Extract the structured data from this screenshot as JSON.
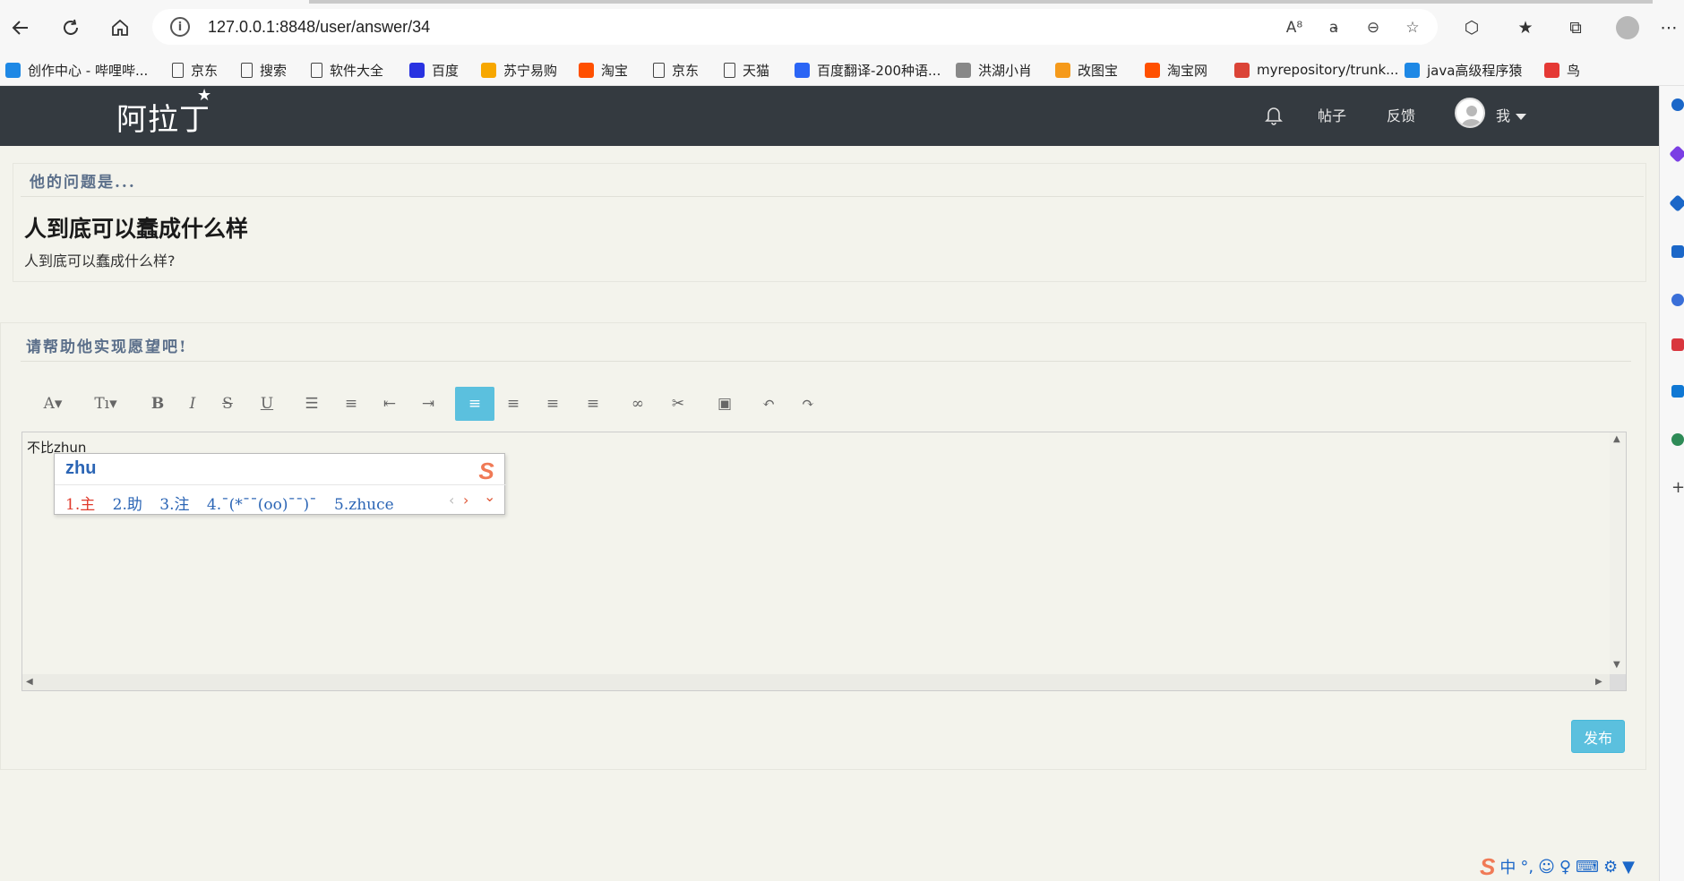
{
  "browser": {
    "url": "127.0.0.1:8848/user/answer/34",
    "info_icon_glyph": "i",
    "nav_icons": [
      "back-arrow-icon",
      "reload-icon",
      "home-icon"
    ],
    "address_icons": [
      "read-aloud-icon",
      "translate-icon",
      "zoom-out-icon",
      "add-favorite-icon"
    ],
    "address_icon_glyphs": [
      "A⁸",
      "a̵",
      "⊖",
      "☆"
    ],
    "toolbar_icons": [
      "extensions-icon",
      "favorites-icon",
      "collections-icon",
      "profile-icon",
      "more-icon"
    ],
    "toolbar_icon_glyphs": [
      "⬡",
      "★",
      "⧉",
      "",
      "⋯"
    ]
  },
  "bookmarks": [
    {
      "label": "创作中心 - 哔哩哔...",
      "icon": "bilibili-icon",
      "color": "#1e88e5"
    },
    {
      "label": "京东",
      "icon": "page-icon"
    },
    {
      "label": "搜索",
      "icon": "page-icon"
    },
    {
      "label": "软件大全",
      "icon": "page-icon"
    },
    {
      "label": "百度",
      "icon": "baidu-paw-icon",
      "color": "#2932e1"
    },
    {
      "label": "苏宁易购",
      "icon": "suning-icon",
      "color": "#f7a700"
    },
    {
      "label": "淘宝",
      "icon": "taobao-icon",
      "color": "#ff5000"
    },
    {
      "label": "京东",
      "icon": "page-icon"
    },
    {
      "label": "天猫",
      "icon": "page-icon"
    },
    {
      "label": "百度翻译-200种语...",
      "icon": "baidu-translate-icon",
      "color": "#2b65f5"
    },
    {
      "label": "洪湖小肖",
      "icon": "bird-icon",
      "color": "#888888"
    },
    {
      "label": "改图宝",
      "icon": "gaitubao-icon",
      "color": "#f59a1b"
    },
    {
      "label": "淘宝网",
      "icon": "taobao-icon",
      "color": "#ff5000"
    },
    {
      "label": "myrepository/trunk...",
      "icon": "chrome-icon",
      "color": "#db4437"
    },
    {
      "label": "java高级程序猿",
      "icon": "bilibili-icon",
      "color": "#1e88e5"
    },
    {
      "label": "鸟",
      "icon": "bird-red-icon",
      "color": "#e53935"
    }
  ],
  "header": {
    "logo": "阿拉丁",
    "logo_star": "★",
    "nav": [
      {
        "label": "帖子"
      },
      {
        "label": "反馈"
      }
    ],
    "user_label": "我"
  },
  "question": {
    "section_title": "他的问题是...",
    "title": "人到底可以蠢成什么样",
    "body": "人到底可以蠢成什么样?"
  },
  "answer": {
    "section_title": "请帮助他实现愿望吧!",
    "toolbar": [
      {
        "name": "font-family-button",
        "glyph": "A▾"
      },
      {
        "name": "font-size-button",
        "glyph": "Tı▾"
      },
      {
        "name": "bold-button",
        "glyph": "B"
      },
      {
        "name": "italic-button",
        "glyph": "I"
      },
      {
        "name": "strikethrough-button",
        "glyph": "S"
      },
      {
        "name": "underline-button",
        "glyph": "U"
      },
      {
        "name": "bullet-list-button",
        "glyph": "☰"
      },
      {
        "name": "numbered-list-button",
        "glyph": "≡"
      },
      {
        "name": "outdent-button",
        "glyph": "⇤"
      },
      {
        "name": "indent-button",
        "glyph": "⇥"
      },
      {
        "name": "align-left-button",
        "glyph": "≡",
        "active": true
      },
      {
        "name": "align-center-button",
        "glyph": "≡"
      },
      {
        "name": "align-right-button",
        "glyph": "≡"
      },
      {
        "name": "justify-button",
        "glyph": "≡"
      },
      {
        "name": "link-button",
        "glyph": "∞"
      },
      {
        "name": "unlink-button",
        "glyph": "✂"
      },
      {
        "name": "image-button",
        "glyph": "▣"
      },
      {
        "name": "undo-button",
        "glyph": "↶"
      },
      {
        "name": "redo-button",
        "glyph": "↷"
      }
    ],
    "editor_text": "不比zhun",
    "publish_label": "发布"
  },
  "ime": {
    "input": "zhu",
    "candidates": [
      "1.主",
      "2.助",
      "3.注",
      "4.¯(*¯¯(oo)¯¯)¯",
      "5.zhuce"
    ],
    "logo": "S",
    "nav_prev": "‹",
    "nav_next": "›",
    "nav_expand": "⌄"
  },
  "tray": {
    "items": [
      "S",
      "中",
      "°,",
      "☺",
      "♀",
      "⌨",
      "⚙",
      "▼"
    ]
  },
  "colors": {
    "header_bg": "#343a40",
    "accent": "#5bc0de",
    "page_bg": "#f3f3ec"
  }
}
